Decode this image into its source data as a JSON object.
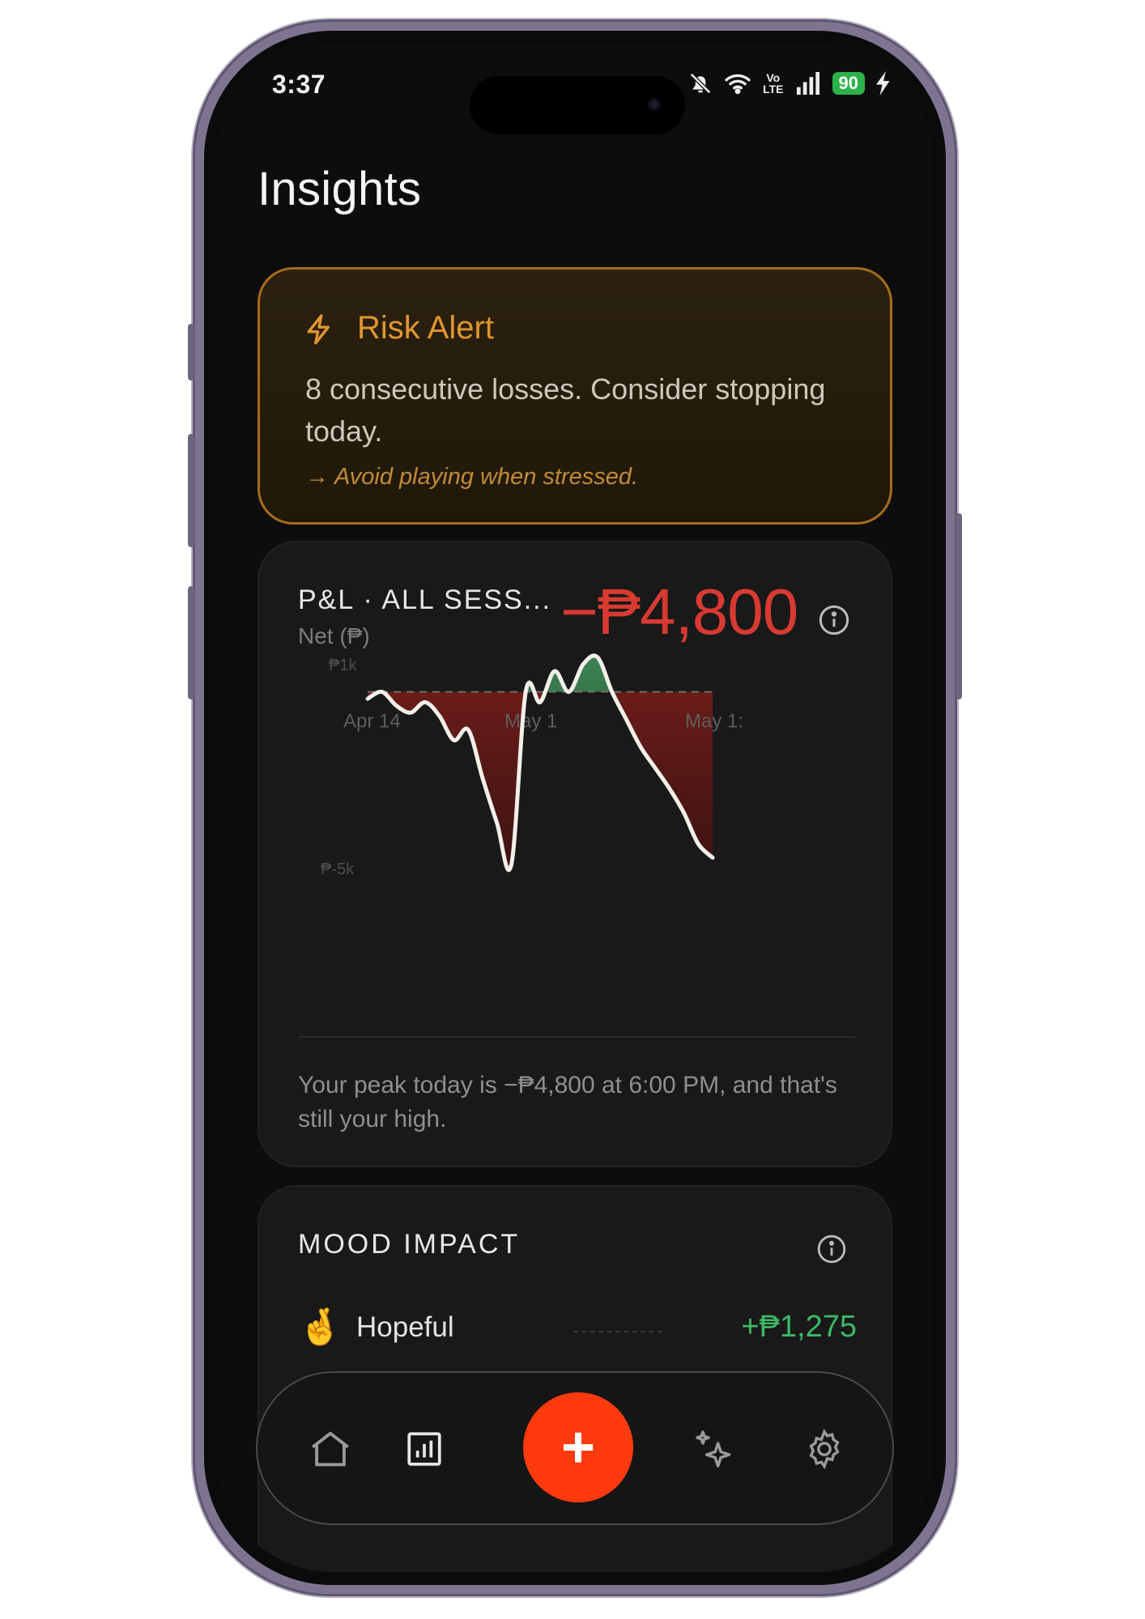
{
  "status_bar": {
    "time": "3:37",
    "volte_top": "Vo",
    "volte_bottom": "LTE",
    "battery": "90"
  },
  "page": {
    "title": "Insights"
  },
  "risk_alert": {
    "title": "Risk Alert",
    "message": "8 consecutive losses. Consider stopping today.",
    "tip": "→ Avoid playing when stressed.",
    "accent_color": "#e0962e",
    "icon": "lightning-icon"
  },
  "pnl_card": {
    "title": "P&L · ALL SESS...",
    "subtitle": "Net (₱)",
    "value": "−₱4,800",
    "value_color": "#d83a32",
    "note": "Your peak today is −₱4,800 at 6:00 PM, and that's still your high.",
    "icon": "info-icon"
  },
  "chart_data": {
    "type": "area",
    "y_tick_labels": [
      "₱1k",
      "₱-5k"
    ],
    "x_tick_labels": [
      "Apr 14",
      "May 1",
      "May 1:"
    ],
    "ylim": [
      -5000,
      1000
    ],
    "baseline": 0,
    "grid": false,
    "y": [
      -200,
      0,
      -400,
      -600,
      -300,
      -700,
      -1400,
      -1100,
      -2500,
      -3800,
      -5000,
      0,
      -300,
      600,
      0,
      800,
      1000,
      0,
      -800,
      -1600,
      -2200,
      -2800,
      -3500,
      -4400,
      -4800
    ],
    "fill_negative_color": "#7a1e1a",
    "fill_positive_color": "#3e8a55",
    "line_color": "#f2eee8"
  },
  "mood_impact": {
    "title": "MOOD IMPACT",
    "rows": [
      {
        "emoji": "🤞",
        "label": "Hopeful",
        "value": "+₱1,275"
      }
    ]
  },
  "nav": {
    "items": [
      "home-icon",
      "stats-icon",
      "add-icon",
      "sparkles-icon",
      "gear-icon"
    ],
    "fab_label": "+",
    "fab_color": "#ff3a0e"
  }
}
